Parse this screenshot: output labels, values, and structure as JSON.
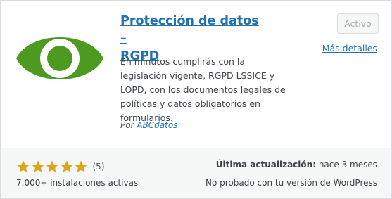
{
  "plugin": {
    "title_line1": "Protección de datos –",
    "title_line2": "RGPD",
    "description": "En minutos cumplirás con la legislación vigente, RGPD LSSICE y LOPD, con los documentos legales de políticas y datos obligatorios en formularios.",
    "author_prefix": "Por",
    "author_name": "ABCdatos",
    "logo_icon": "eye-icon",
    "logo_color": "#4c9a1f"
  },
  "actions": {
    "status_button": "Activo",
    "details_link": "Más detalles"
  },
  "footer": {
    "rating": 5,
    "rating_count": "(5)",
    "star_color": "#dba617",
    "installs": "7.000+ instalaciones activas",
    "last_updated_label": "Última actualización:",
    "last_updated_value": "hace 3 meses",
    "compatibility": "No probado con tu versión de WordPress"
  }
}
